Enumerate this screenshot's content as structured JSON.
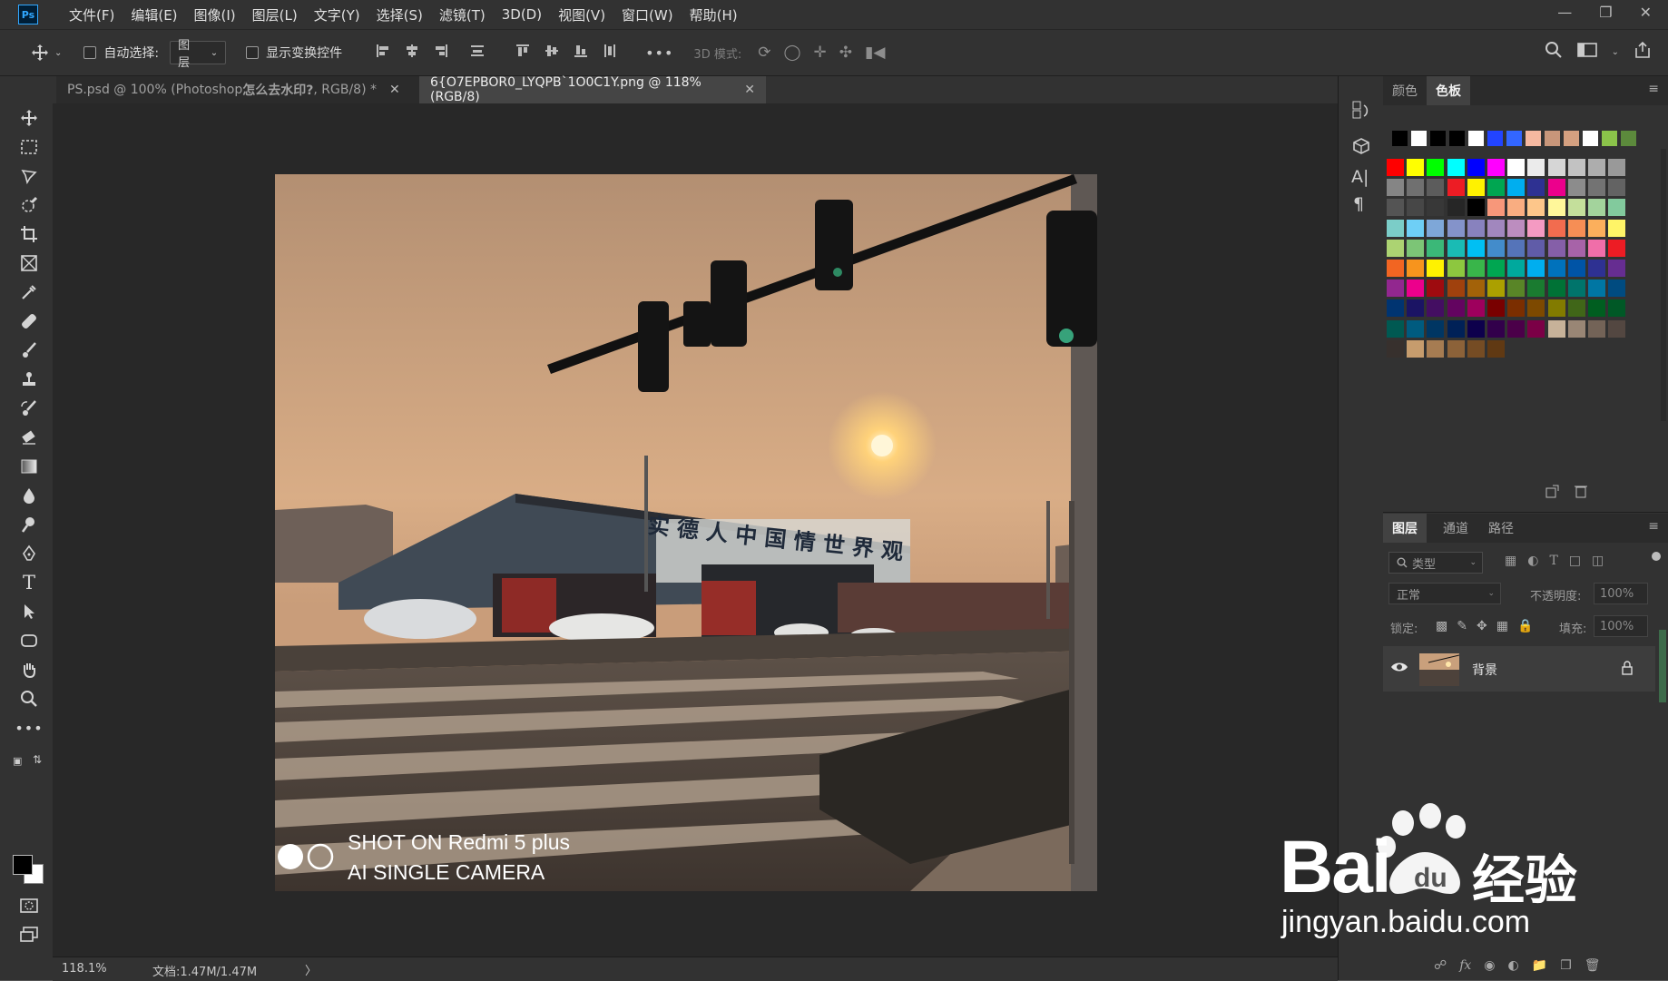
{
  "app": {
    "logo_text": "Ps"
  },
  "menu": [
    "文件(F)",
    "编辑(E)",
    "图像(I)",
    "图层(L)",
    "文字(Y)",
    "选择(S)",
    "滤镜(T)",
    "3D(D)",
    "视图(V)",
    "窗口(W)",
    "帮助(H)"
  ],
  "options_bar": {
    "auto_select_label": "自动选择:",
    "auto_select_target": "图层",
    "show_transform_label": "显示变换控件",
    "mode_3d_label": "3D 模式:"
  },
  "tabs": [
    {
      "title_prefix": "PS.psd @ 100% (Photoshop",
      "title_bold": "怎么去水印?",
      "title_suffix": ", RGB/8) *",
      "active": false
    },
    {
      "title_prefix": "6{O7EPBOR0_LYQPB`1O0C1Y.png @ 118%(RGB/8)",
      "title_bold": "",
      "title_suffix": "",
      "active": true
    }
  ],
  "photo": {
    "overlay_line1": "SHOT ON Redmi 5 plus",
    "overlay_line2": "AI SINGLE CAMERA",
    "sign_text": "实 德 人   中 国 情   世 界 观"
  },
  "status": {
    "zoom": "118.1%",
    "doc": "文档:1.47M/1.47M",
    "arrow": "〉"
  },
  "color_panel": {
    "tabs": [
      "颜色",
      "色板"
    ],
    "active_tab": "色板",
    "recent_colors": [
      "#000000",
      "#ffffff",
      "#000000",
      "#000000",
      "#ffffff",
      "#2244ff",
      "#3366ff",
      "#f5b8a0",
      "#c8967a",
      "#d4a080",
      "#ffffff",
      "#8bc34a",
      "#5c8a3c"
    ],
    "swatches": [
      "#ff0000",
      "#ffff00",
      "#00ff00",
      "#00ffff",
      "#0000ff",
      "#ff00ff",
      "#ffffff",
      "#ebebeb",
      "#d6d6d6",
      "#c2c2c2",
      "#adadad",
      "#999999",
      "#858585",
      "#707070",
      "#5c5c5c",
      "#ed1c24",
      "#fff200",
      "#00a651",
      "#00aeef",
      "#2e3192",
      "#ec008c",
      "#8c8c8c",
      "#737373",
      "#636363",
      "#545454",
      "#474747",
      "#383838",
      "#262626",
      "#000000",
      "#f7977a",
      "#f9ad81",
      "#fdc68a",
      "#fff79a",
      "#c4df9b",
      "#a3d39c",
      "#82ca9d",
      "#7bcdc8",
      "#6ecff6",
      "#7ea7d8",
      "#8493ca",
      "#8882be",
      "#a187be",
      "#bc8dbf",
      "#f49ac2",
      "#f26c4f",
      "#f68e55",
      "#fbaf5c",
      "#fff467",
      "#acd372",
      "#7cc576",
      "#3bb878",
      "#1abbb4",
      "#00bff3",
      "#438ccb",
      "#5574b9",
      "#605ca8",
      "#855fa8",
      "#a763a8",
      "#f06ea9",
      "#ed1c24",
      "#f26522",
      "#f7941d",
      "#fff200",
      "#8dc73f",
      "#39b54a",
      "#00a651",
      "#00a99d",
      "#00aeef",
      "#0072bc",
      "#0054a6",
      "#2e3192",
      "#662d91",
      "#92278f",
      "#ec008c",
      "#9e0b0f",
      "#a0410d",
      "#a36209",
      "#aba000",
      "#598527",
      "#1a7b30",
      "#007236",
      "#00746b",
      "#0076a3",
      "#004b80",
      "#003471",
      "#1b1464",
      "#440e62",
      "#630460",
      "#9e005d",
      "#790000",
      "#7b2e00",
      "#7d4900",
      "#827b00",
      "#406618",
      "#005e20",
      "#005826",
      "#005952",
      "#005b7f",
      "#003663",
      "#002157",
      "#0d004c",
      "#32004b",
      "#4b0049",
      "#7b0046",
      "#c7b299",
      "#998675",
      "#736357",
      "#534741",
      "#37302d",
      "#c69c6d",
      "#a67c52",
      "#8c6239",
      "#754c24",
      "#603913"
    ]
  },
  "layers_panel": {
    "tabs": [
      "图层",
      "通道",
      "路径"
    ],
    "active_tab": "图层",
    "filter_label": "类型",
    "blend_mode": "正常",
    "opacity_label": "不透明度:",
    "opacity_value": "100%",
    "lock_label": "锁定:",
    "fill_label": "填充:",
    "fill_value": "100%",
    "layers": [
      {
        "name": "背景",
        "visible": true,
        "locked": true
      }
    ]
  },
  "watermark": {
    "brand": "Bai",
    "du": "du",
    "jingyan": "经验",
    "url": "jingyan.baidu.com"
  }
}
